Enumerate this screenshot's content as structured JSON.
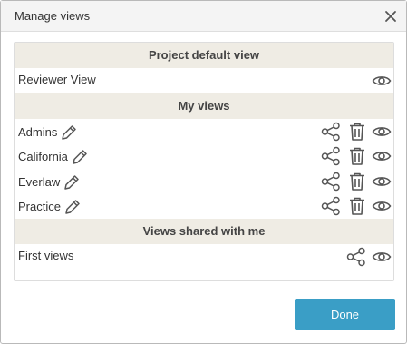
{
  "dialog": {
    "title": "Manage views",
    "close_icon": "close-icon"
  },
  "sections": {
    "project_default": {
      "header": "Project default view",
      "items": [
        {
          "label": "Reviewer View"
        }
      ]
    },
    "my_views": {
      "header": "My views",
      "items": [
        {
          "label": "Admins"
        },
        {
          "label": "California"
        },
        {
          "label": "Everlaw"
        },
        {
          "label": "Practice"
        }
      ]
    },
    "shared": {
      "header": "Views shared with me",
      "items": [
        {
          "label": "First views"
        }
      ]
    }
  },
  "footer": {
    "done_label": "Done"
  },
  "icons": {
    "edit": "pencil-icon",
    "share": "share-icon",
    "delete": "trash-icon",
    "view": "eye-icon"
  },
  "colors": {
    "section_header_bg": "#efece4",
    "done_button": "#3a9ec6",
    "icon": "#555555"
  }
}
